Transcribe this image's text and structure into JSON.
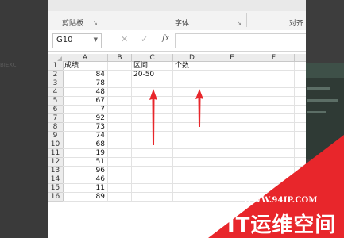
{
  "background": {
    "partial_text": "BIEXC"
  },
  "ribbon": {
    "clipboard_label": "剪贴板",
    "font_label": "字体",
    "align_label": "对齐"
  },
  "formula_bar": {
    "name_box": "G10",
    "fx_label": "fx",
    "formula_value": ""
  },
  "sheet": {
    "columns": [
      "A",
      "B",
      "C",
      "D",
      "E",
      "F"
    ],
    "rows": [
      {
        "n": "1",
        "a": "成绩",
        "c": "区间",
        "d": "个数"
      },
      {
        "n": "2",
        "a": "84",
        "c": "20-50",
        "d": ""
      },
      {
        "n": "3",
        "a": "78",
        "c": "",
        "d": ""
      },
      {
        "n": "4",
        "a": "48",
        "c": "",
        "d": ""
      },
      {
        "n": "5",
        "a": "67",
        "c": "",
        "d": ""
      },
      {
        "n": "6",
        "a": "7",
        "c": "",
        "d": ""
      },
      {
        "n": "7",
        "a": "92",
        "c": "",
        "d": ""
      },
      {
        "n": "8",
        "a": "73",
        "c": "",
        "d": ""
      },
      {
        "n": "9",
        "a": "74",
        "c": "",
        "d": ""
      },
      {
        "n": "10",
        "a": "68",
        "c": "",
        "d": ""
      },
      {
        "n": "11",
        "a": "19",
        "c": "",
        "d": ""
      },
      {
        "n": "12",
        "a": "51",
        "c": "",
        "d": ""
      },
      {
        "n": "13",
        "a": "96",
        "c": "",
        "d": ""
      },
      {
        "n": "14",
        "a": "46",
        "c": "",
        "d": ""
      },
      {
        "n": "15",
        "a": "11",
        "c": "",
        "d": ""
      },
      {
        "n": "16",
        "a": "89",
        "c": "",
        "d": ""
      }
    ]
  },
  "watermark": {
    "url": "WWW.94IP.COM",
    "brand": "IT运维空间"
  },
  "colors": {
    "arrow": "#e8262b",
    "watermark_red": "#e8262b",
    "grid_line": "#e2e2e2"
  }
}
